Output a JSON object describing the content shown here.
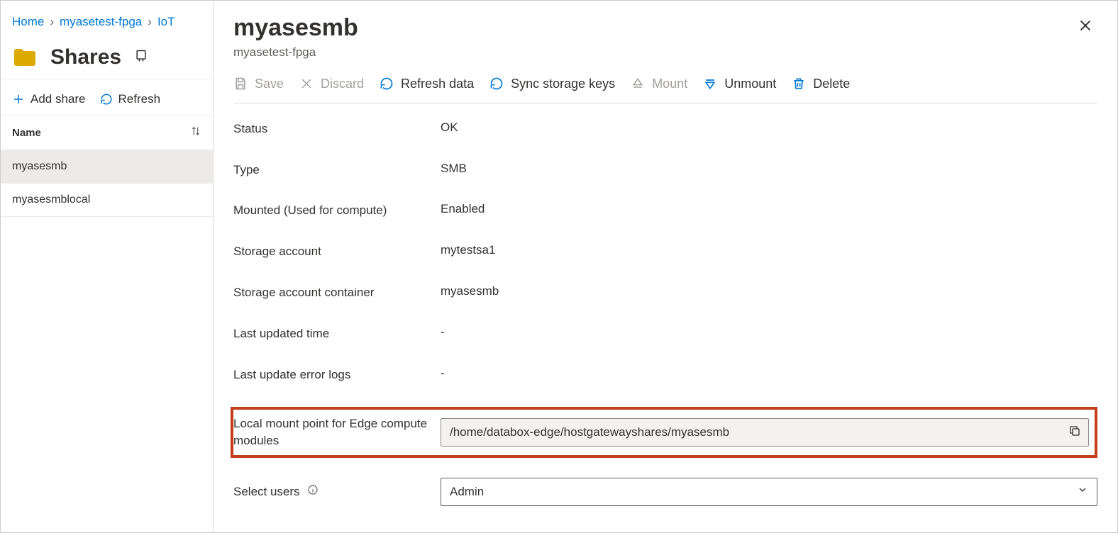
{
  "breadcrumb": {
    "home": "Home",
    "resource": "myasetest-fpga",
    "iot": "IoT"
  },
  "sidebar": {
    "title": "Shares",
    "add_share": "Add share",
    "refresh": "Refresh",
    "col_name": "Name",
    "items": [
      {
        "name": "myasesmb"
      },
      {
        "name": "myasesmblocal"
      }
    ]
  },
  "detail": {
    "title": "myasesmb",
    "subtitle": "myasetest-fpga",
    "toolbar": {
      "save": "Save",
      "discard": "Discard",
      "refresh_data": "Refresh data",
      "sync_storage": "Sync storage keys",
      "mount": "Mount",
      "unmount": "Unmount",
      "delete": "Delete"
    },
    "props": {
      "status_label": "Status",
      "status_value": "OK",
      "type_label": "Type",
      "type_value": "SMB",
      "mounted_label": "Mounted (Used for compute)",
      "mounted_value": "Enabled",
      "storage_account_label": "Storage account",
      "storage_account_value": "mytestsa1",
      "container_label": "Storage account container",
      "container_value": "myasesmb",
      "last_updated_label": "Last updated time",
      "last_updated_value": "-",
      "error_logs_label": "Last update error logs",
      "error_logs_value": "-",
      "mount_point_label": "Local mount point for Edge compute modules",
      "mount_point_value": "/home/databox-edge/hostgatewayshares/myasesmb",
      "select_users_label": "Select users",
      "select_users_value": "Admin"
    }
  }
}
